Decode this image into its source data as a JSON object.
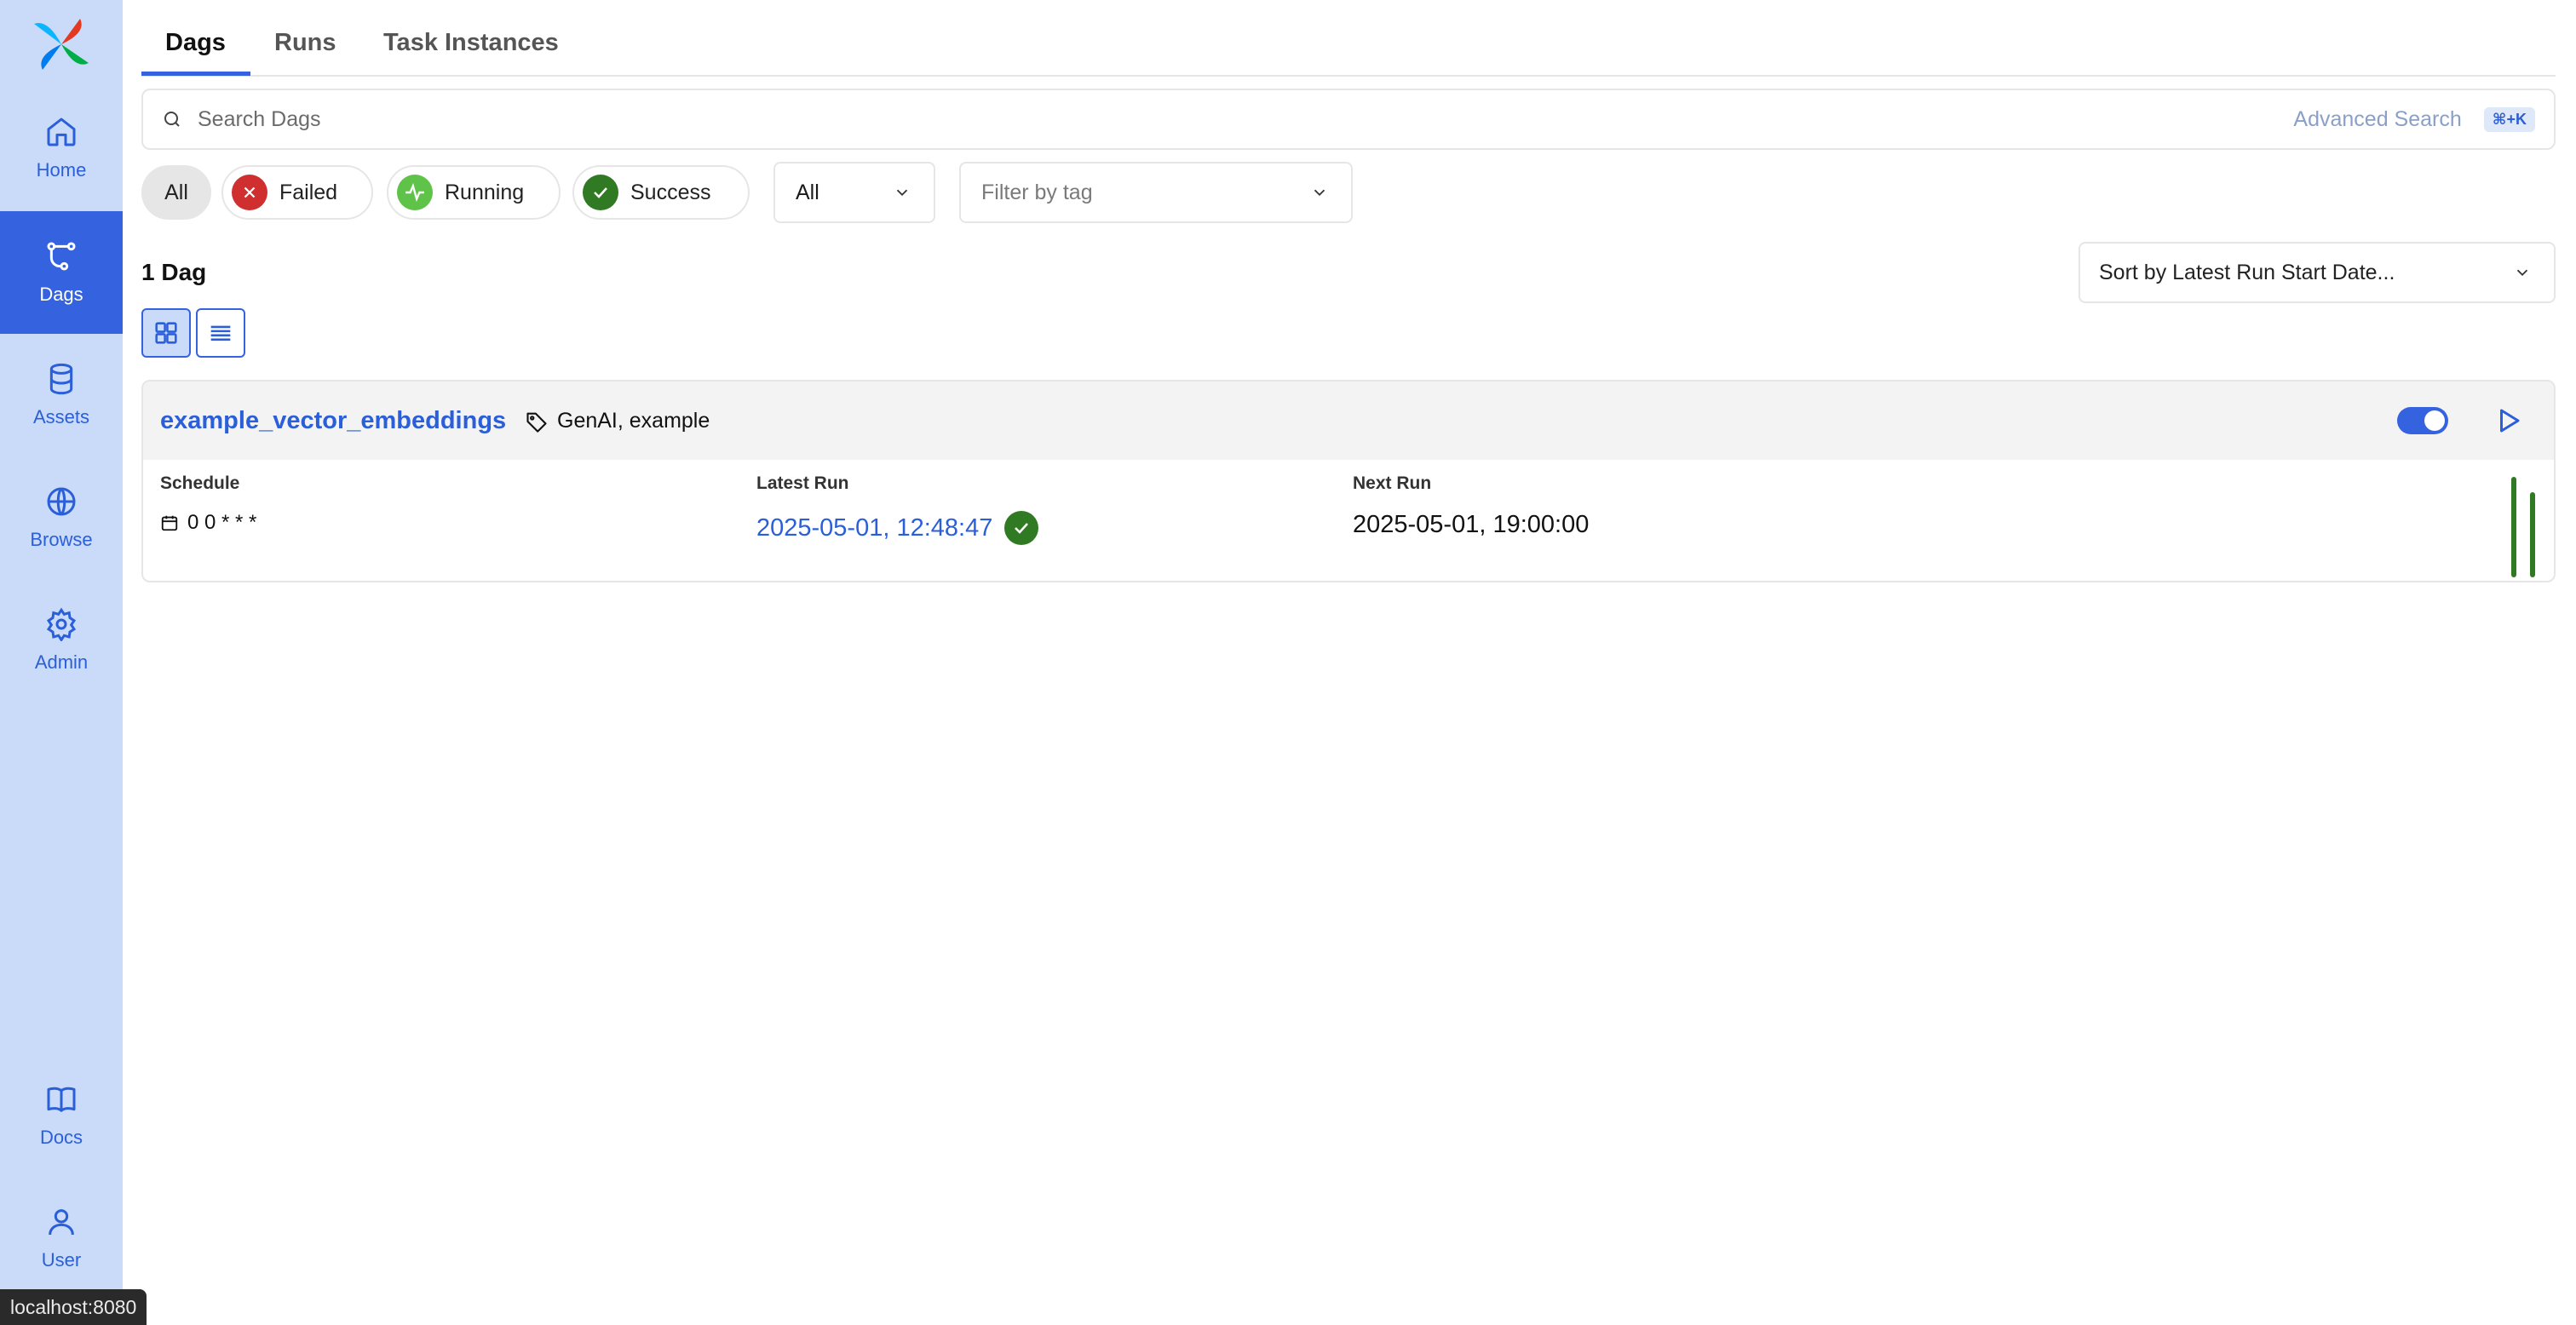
{
  "sidebar": {
    "items": [
      {
        "label": "Home"
      },
      {
        "label": "Dags"
      },
      {
        "label": "Assets"
      },
      {
        "label": "Browse"
      },
      {
        "label": "Admin"
      },
      {
        "label": "Docs"
      },
      {
        "label": "User"
      }
    ],
    "active_color": "#3563e0",
    "background_color": "#c9dbf8"
  },
  "tabs": [
    {
      "label": "Dags"
    },
    {
      "label": "Runs"
    },
    {
      "label": "Task Instances"
    }
  ],
  "search": {
    "placeholder": "Search Dags",
    "advanced_label": "Advanced Search",
    "shortcut": "⌘+K"
  },
  "filters": {
    "state_pills": [
      {
        "label": "All"
      },
      {
        "label": "Failed",
        "color": "#d02f2f"
      },
      {
        "label": "Running",
        "color": "#5fc34a"
      },
      {
        "label": "Success",
        "color": "#2f7a23"
      }
    ],
    "paused_select": {
      "value": "All"
    },
    "tag_select": {
      "placeholder": "Filter by tag"
    }
  },
  "list": {
    "count_label": "1 Dag",
    "sort_label": "Sort by Latest Run Start Date..."
  },
  "dag": {
    "name": "example_vector_embeddings",
    "tags": "GenAI, example",
    "schedule_label": "Schedule",
    "schedule": "0 0 * * *",
    "latest_run_label": "Latest Run",
    "latest_run": "2025-05-01, 12:48:47",
    "latest_run_state_color": "#2f7a23",
    "next_run_label": "Next Run",
    "next_run": "2025-05-01, 19:00:00",
    "enabled": true
  },
  "status_bar": {
    "url": "localhost:8080"
  }
}
